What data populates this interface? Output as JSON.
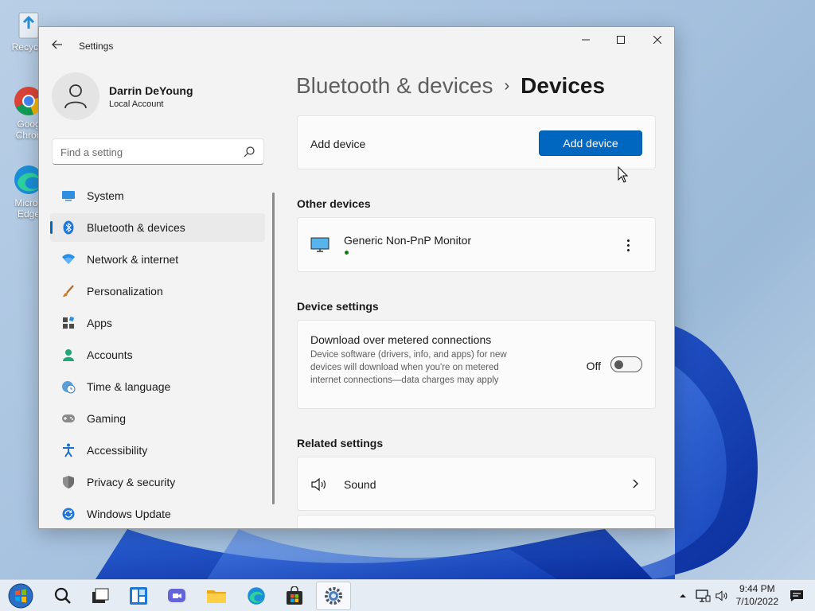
{
  "desktop": {
    "icons": [
      {
        "label": "Recycle",
        "icon": "recycle-bin-icon"
      },
      {
        "label": "Goog Chron",
        "icon": "chrome-icon"
      },
      {
        "label": "Micros Edge",
        "icon": "edge-icon"
      }
    ]
  },
  "window": {
    "app_title": "Settings",
    "controls": {
      "minimize": "minimize-icon",
      "maximize": "maximize-icon",
      "close": "close-icon"
    }
  },
  "profile": {
    "name": "Darrin DeYoung",
    "account_type": "Local Account"
  },
  "search": {
    "placeholder": "Find a setting"
  },
  "nav": {
    "items": [
      {
        "label": "System",
        "icon": "monitor-icon",
        "active": false
      },
      {
        "label": "Bluetooth & devices",
        "icon": "bluetooth-icon",
        "active": true
      },
      {
        "label": "Network & internet",
        "icon": "wifi-icon",
        "active": false
      },
      {
        "label": "Personalization",
        "icon": "brush-icon",
        "active": false
      },
      {
        "label": "Apps",
        "icon": "apps-icon",
        "active": false
      },
      {
        "label": "Accounts",
        "icon": "person-icon",
        "active": false
      },
      {
        "label": "Time & language",
        "icon": "globe-clock-icon",
        "active": false
      },
      {
        "label": "Gaming",
        "icon": "gamepad-icon",
        "active": false
      },
      {
        "label": "Accessibility",
        "icon": "accessibility-icon",
        "active": false
      },
      {
        "label": "Privacy & security",
        "icon": "shield-icon",
        "active": false
      },
      {
        "label": "Windows Update",
        "icon": "update-icon",
        "active": false
      }
    ]
  },
  "breadcrumb": {
    "parent": "Bluetooth & devices",
    "separator": "›",
    "current": "Devices"
  },
  "add_device": {
    "label": "Add device",
    "button": "Add device"
  },
  "other_devices": {
    "heading": "Other devices",
    "items": [
      {
        "name": "Generic Non-PnP Monitor",
        "icon": "monitor-icon",
        "status_color": "#0f7b0f"
      }
    ]
  },
  "device_settings": {
    "heading": "Device settings",
    "metered": {
      "title": "Download over metered connections",
      "description": "Device software (drivers, info, and apps) for new devices will download when you're on metered internet connections—data charges may apply",
      "state_label": "Off",
      "enabled": false
    }
  },
  "related_settings": {
    "heading": "Related settings",
    "items": [
      {
        "label": "Sound",
        "icon": "speaker-icon"
      }
    ]
  },
  "taskbar": {
    "apps": [
      "start-icon",
      "search-icon",
      "task-view-icon",
      "widgets-icon",
      "chat-icon",
      "file-explorer-icon",
      "edge-icon",
      "store-icon",
      "settings-icon"
    ],
    "time": "9:44 PM",
    "date": "7/10/2022"
  },
  "colors": {
    "accent": "#0067c0",
    "status_connected": "#0f7b0f"
  }
}
